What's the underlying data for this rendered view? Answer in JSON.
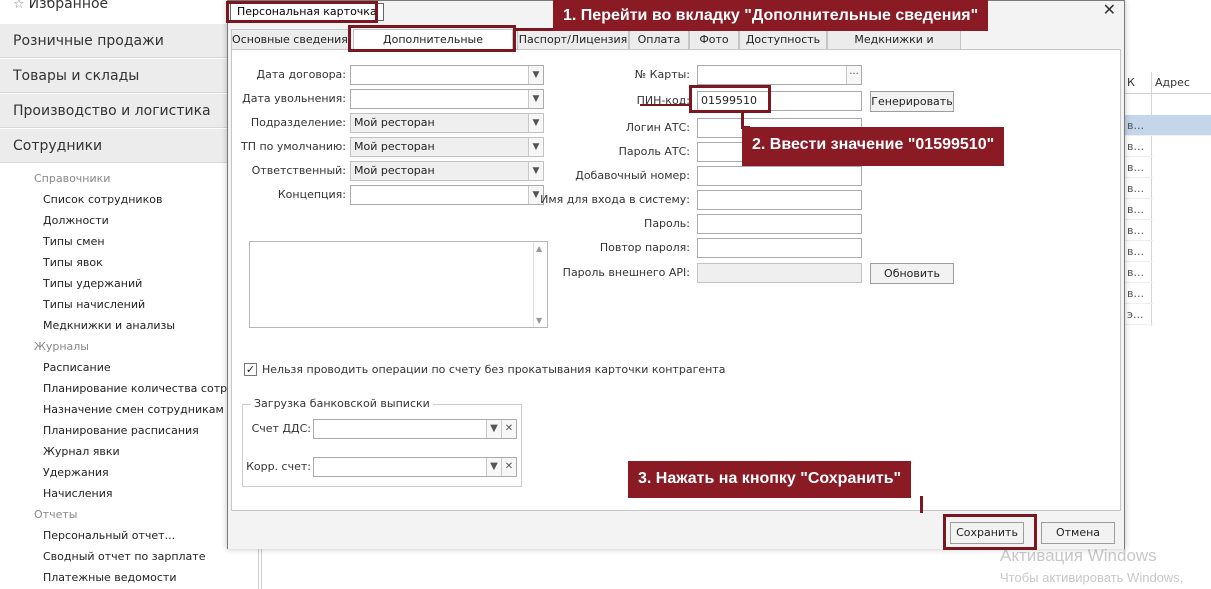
{
  "sidebar": {
    "favorites": "Избранное",
    "main_items": [
      "Розничные продажи",
      "Товары и склады",
      "Производство и логистика",
      "Сотрудники"
    ],
    "groups": {
      "references": {
        "title": "Справочники",
        "items": [
          "Список сотрудников",
          "Должности",
          "Типы смен",
          "Типы явок",
          "Типы удержаний",
          "Типы начислений",
          "Медкнижки и анализы"
        ]
      },
      "journals": {
        "title": "Журналы",
        "items": [
          "Расписание",
          "Планирование количества сотрудн...",
          "Назначение смен сотрудникам",
          "Планирование расписания",
          "Журнал явки",
          "Удержания",
          "Начисления"
        ]
      },
      "reports": {
        "title": "Отчеты",
        "items": [
          "Персональный отчет...",
          "Сводный отчет по зарплате",
          "Платежные ведомости"
        ]
      }
    }
  },
  "background_table": {
    "col1_header": "К",
    "col2_header": "Адрес",
    "cells": [
      "в...",
      "в...",
      "в...",
      "в...",
      "в...",
      "в...",
      "в...",
      "в...",
      "в...",
      "э..."
    ]
  },
  "dialog": {
    "title": "Персональная карточка",
    "tabs": [
      "Основные сведения",
      "Дополнительные сведения",
      "Паспорт/Лицензия",
      "Оплата",
      "Фото",
      "Доступность",
      "Медкнижки и анализы"
    ],
    "active_tab": "Дополнительные сведения",
    "left_form": {
      "contract_date_label": "Дата договора:",
      "dismissal_date_label": "Дата увольнения:",
      "department_label": "Подразделение:",
      "department_value": "Мой ресторан",
      "default_pos_label": "ТП по умолчанию:",
      "default_pos_value": "Мой ресторан",
      "responsible_label": "Ответственный:",
      "responsible_value": "Мой ресторан",
      "concept_label": "Концепция:"
    },
    "right_form": {
      "card_number_label": "№ Карты:",
      "pin_label": "ПИН-код:",
      "pin_value": "01599510",
      "generate_button": "Генерировать",
      "pbx_login_label": "Логин АТС:",
      "pbx_password_label": "Пароль АТС:",
      "extension_label": "Добавочный номер:",
      "login_name_label": "Имя для входа в систему:",
      "password_label": "Пароль:",
      "password_repeat_label": "Повтор пароля:",
      "external_api_password_label": "Пароль внешнего API:",
      "refresh_button": "Обновить"
    },
    "checkbox_label": "Нельзя проводить операции по счету без прокатывания карточки контрагента",
    "checkbox_checked": true,
    "bank_group": {
      "legend": "Загрузка банковской выписки",
      "dds_account_label": "Счет ДДС:",
      "corr_account_label": "Корр. счет:"
    },
    "footer": {
      "save_button": "Сохранить",
      "cancel_button": "Отмена"
    }
  },
  "annotations": {
    "step1": "1.  Перейти во вкладку \"Дополнительные сведения\"",
    "step2": "2. Ввести значение \"01599510\"",
    "step3": "3. Нажать на кнопку \"Сохранить\"",
    "color": "#8a1b24"
  },
  "watermark": {
    "line1": "Активация Windows",
    "line2": "Чтобы активировать Windows,"
  }
}
